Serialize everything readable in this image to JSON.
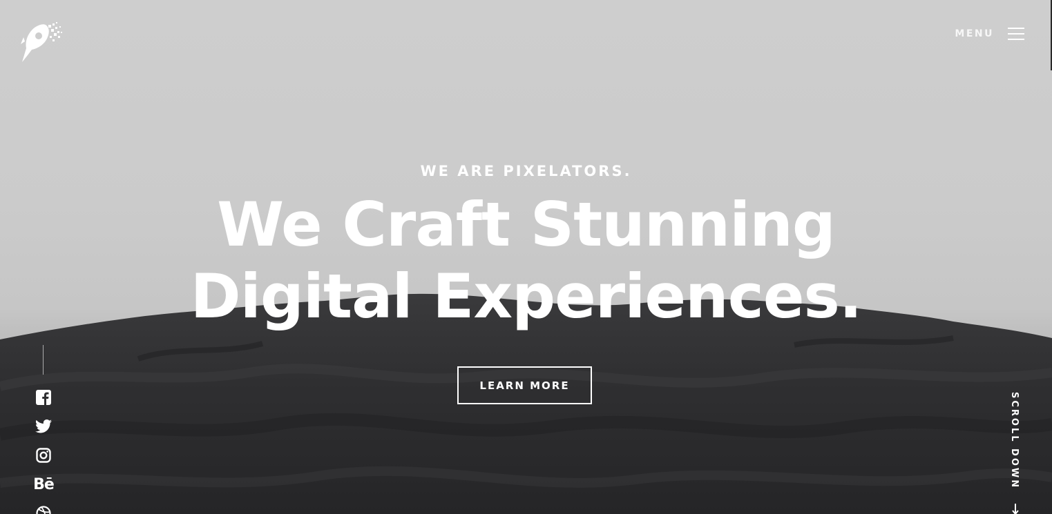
{
  "header": {
    "menu_label": "MENU",
    "logo_icon": "pixelators-rocket-logo",
    "menu_icon": "hamburger-icon"
  },
  "hero": {
    "eyebrow": "WE ARE PIXELATORS.",
    "headline_line1": "We Craft Stunning",
    "headline_line2": "Digital Experiences.",
    "cta_label": "LEARN MORE"
  },
  "social": {
    "items": [
      {
        "name": "facebook",
        "icon": "facebook-icon"
      },
      {
        "name": "twitter",
        "icon": "twitter-icon"
      },
      {
        "name": "instagram",
        "icon": "instagram-icon"
      },
      {
        "name": "behance",
        "icon": "behance-icon",
        "text": "Bē"
      },
      {
        "name": "dribbble",
        "icon": "dribbble-icon"
      }
    ]
  },
  "scroll": {
    "label": "SCROLL DOWN",
    "icon": "arrow-down-icon"
  },
  "colors": {
    "sky": "#cecece",
    "dune": "#2f2f31",
    "text": "#ffffff"
  }
}
